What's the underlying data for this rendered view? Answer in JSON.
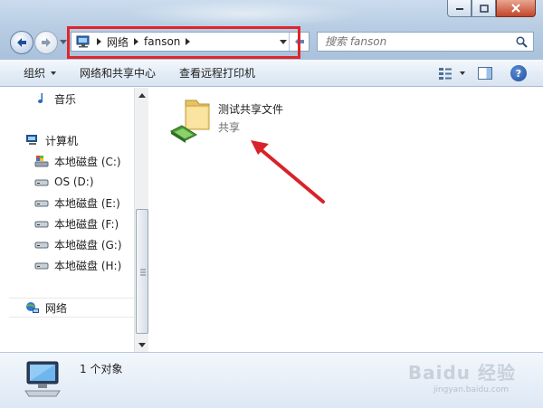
{
  "window": {
    "buttons": {
      "minimize": "minimize",
      "maximize": "maximize",
      "close": "close"
    }
  },
  "address": {
    "crumbs": [
      "网络",
      "fanson"
    ]
  },
  "search": {
    "placeholder": "搜索 fanson"
  },
  "toolbar": {
    "organize": "组织",
    "network_sharing_center": "网络和共享中心",
    "view_remote_printers": "查看远程打印机"
  },
  "nav": {
    "items": [
      {
        "label": "音乐",
        "icon": "music-note-icon"
      },
      {
        "label": "计算机",
        "icon": "computer-icon"
      },
      {
        "label": "本地磁盘 (C:)",
        "icon": "system-drive-icon"
      },
      {
        "label": "OS (D:)",
        "icon": "drive-icon"
      },
      {
        "label": "本地磁盘 (E:)",
        "icon": "drive-icon"
      },
      {
        "label": "本地磁盘 (F:)",
        "icon": "drive-icon"
      },
      {
        "label": "本地磁盘 (G:)",
        "icon": "drive-icon"
      },
      {
        "label": "本地磁盘 (H:)",
        "icon": "drive-icon"
      },
      {
        "label": "网络",
        "icon": "network-icon"
      }
    ]
  },
  "content": {
    "share": {
      "name": "测试共享文件",
      "type": "共享"
    }
  },
  "details": {
    "count": "1 个对象"
  },
  "watermark": {
    "main": "Baidu 经验",
    "sub": "jingyan.baidu.com"
  },
  "colors": {
    "highlight": "#e0252b",
    "arrow": "#d8232a"
  }
}
